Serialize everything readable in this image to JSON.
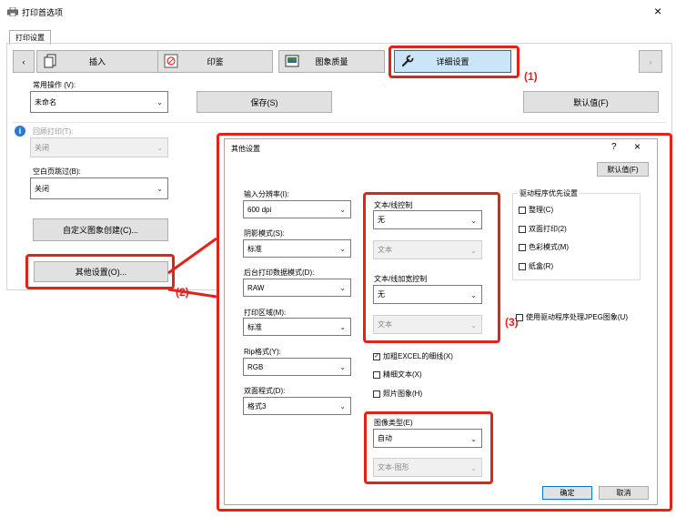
{
  "window": {
    "title": "打印首选项",
    "close": "×"
  },
  "tab": "打印设置",
  "nav": {
    "prev": "‹",
    "next": "›",
    "tabs": [
      {
        "label": "插入",
        "icon": "pages-icon"
      },
      {
        "label": "印鉴",
        "icon": "stamp-icon"
      },
      {
        "label": "图象质量",
        "icon": "image-quality-icon"
      },
      {
        "label": "详细设置",
        "icon": "wrench-icon"
      }
    ]
  },
  "common": {
    "label": "常用操作 (V):",
    "value": "未命名",
    "save": "保存(S)",
    "default": "默认值(F)"
  },
  "left": {
    "collate_label": "回顾打印(T):",
    "collate_value": "关闭",
    "blank_label": "空白页跳过(B):",
    "blank_value": "关闭",
    "custom_image_btn": "自定义图象创建(C)...",
    "other_settings_btn": "其他设置(O)..."
  },
  "dialog": {
    "title": "其他设置",
    "help": "?",
    "close": "×",
    "default_btn": "默认值(F)",
    "input_res_label": "输入分辨率(I):",
    "input_res_value": "600 dpi",
    "resolution_mode_label": "阴影模式(S):",
    "resolution_mode_value": "标准",
    "bg_print_label": "后台打印数据模式(D):",
    "bg_print_value": "RAW",
    "print_area_label": "打印区域(M):",
    "print_area_value": "标准",
    "rip_label": "Rip格式(Y):",
    "rip_value": "RGB",
    "duplex_label": "双面程式(D):",
    "duplex_value": "格式3",
    "text_line_control_label": "文本/线控制",
    "text_line_control_value": "无",
    "text_disabled_value": "文本",
    "text_line_bold_label": "文本/线加宽控制",
    "text_line_bold_value": "无",
    "text_disabled_value2": "文本",
    "excel_bold": "加粗EXCEL的细线(X)",
    "fine_text": "精细文本(X)",
    "photo_image": "照片图象(H)",
    "image_type_label": "图像类型(E)",
    "image_type_value": "自动",
    "image_type_sub_value": "文本-图形",
    "driver_priority_title": "驱动程序优先设置",
    "priority_items": [
      "整理(C)",
      "双面打印(2)",
      "色彩模式(M)",
      "纸盒(R)"
    ],
    "jpeg": "使用驱动程序处理JPEG图象(U)",
    "ok": "确定",
    "cancel": "取消"
  },
  "callouts": {
    "c1": "(1)",
    "c2": "(2)",
    "c3": "(3)"
  },
  "colors": {
    "accent": "#e2231a",
    "selected_tab": "#cce4f7"
  }
}
